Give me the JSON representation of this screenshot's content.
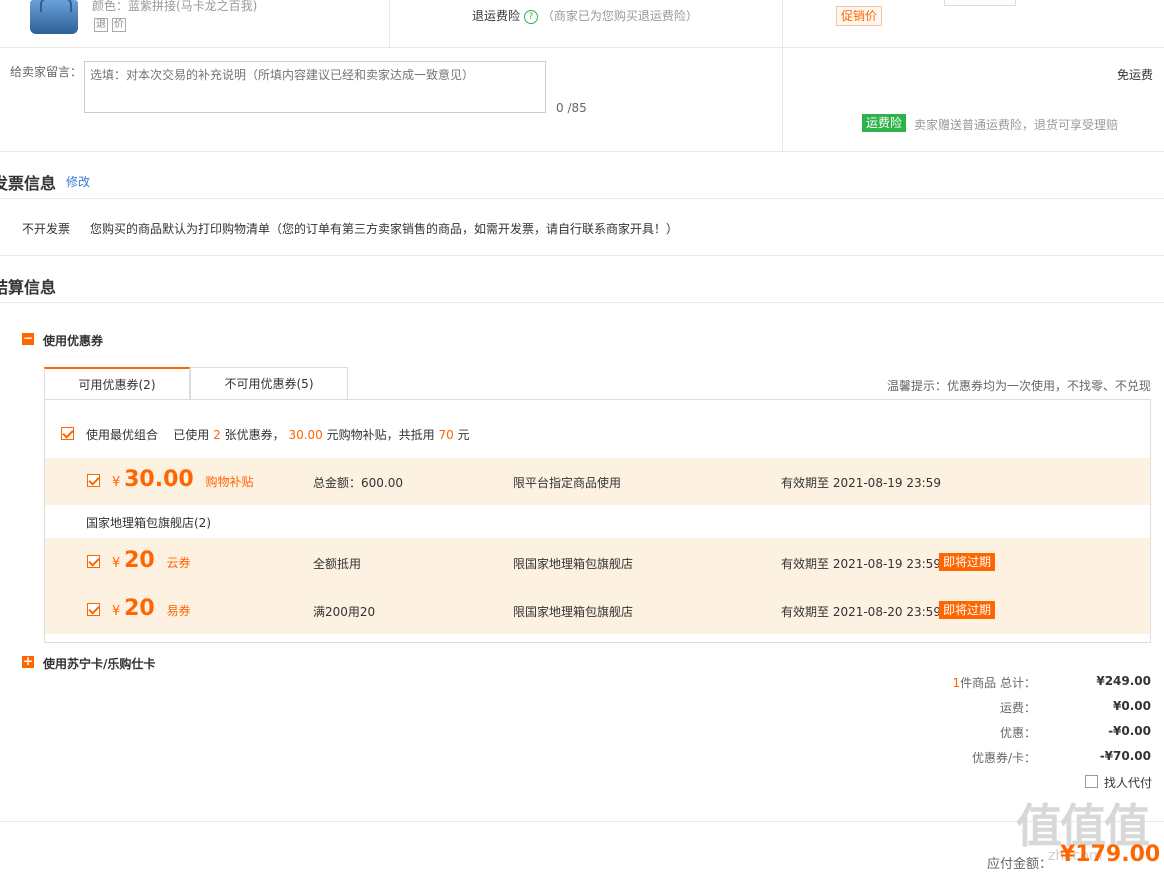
{
  "product": {
    "color_line": "颜色：蓝紫拼接(马卡龙之百我)",
    "tags": [
      "退",
      "价"
    ],
    "insurance_label": "退运费险",
    "insurance_note": "（商家已为您购买退运费险）",
    "promo_label": "促销价"
  },
  "message": {
    "label": "给卖家留言：",
    "placeholder": "选填：对本次交易的补充说明（所填内容建议已经和卖家达成一致意见）",
    "counter": "0 /85",
    "shipping": "免运费",
    "insurance_badge": "运费险",
    "insurance_text": "卖家赠送普通运费险，退货可享受理赔"
  },
  "invoice": {
    "title": "发票信息",
    "edit_link": "修改",
    "type": "不开发票",
    "description": "您购买的商品默认为打印购物清单（您的订单有第三方卖家销售的商品，如需开发票，请自行联系商家开具！）"
  },
  "settlement": {
    "title": "结算信息",
    "coupon_toggle": "使用优惠券",
    "tabs": [
      {
        "label": "可用优惠券(2)"
      },
      {
        "label": "不可用优惠券(5)"
      }
    ],
    "tip": "温馨提示：优惠券均为一次使用，不找零、不兑现",
    "best_combo": {
      "label": "使用最优组合",
      "prefix": "已使用",
      "count": "2",
      "mid1": "张优惠券，",
      "subsidy": "30.00",
      "mid2": "元购物补贴，共抵用",
      "total": "70",
      "suffix": "元"
    },
    "platform_coupon": {
      "yen": "¥",
      "amount": "30.00",
      "type": "购物补贴",
      "condition": "总金额：600.00",
      "scope": "限平台指定商品使用",
      "expiry": "有效期至 2021-08-19 23:59"
    },
    "store_name": "国家地理箱包旗舰店(2)",
    "store_coupons": [
      {
        "yen": "¥",
        "amount": "20",
        "type": "云券",
        "condition": "全额抵用",
        "scope": "限国家地理箱包旗舰店",
        "expiry": "有效期至 2021-08-19 23:59",
        "badge": "即将过期"
      },
      {
        "yen": "¥",
        "amount": "20",
        "type": "易券",
        "condition": "满200用20",
        "scope": "限国家地理箱包旗舰店",
        "expiry": "有效期至 2021-08-20 23:59",
        "badge": "即将过期"
      }
    ],
    "card_toggle": "使用苏宁卡/乐购仕卡"
  },
  "summary": {
    "items_count": "1",
    "items_label": "件商品 总计：",
    "items_total": "¥249.00",
    "shipping_label": "运费：",
    "shipping_value": "¥0.00",
    "discount_label": "优惠：",
    "discount_value": "-¥0.00",
    "coupon_label": "优惠券/卡：",
    "coupon_value": "-¥70.00",
    "proxy_pay": "找人代付",
    "pay_label": "应付金额：",
    "pay_value": "¥179.00"
  },
  "watermark": {
    "main": "值值值",
    "sub": "zhi.com"
  },
  "colors": {
    "accent": "#ff6600",
    "coupon_bg": "#fdf1e1",
    "green": "#2db34a",
    "link": "#3a7bd5"
  }
}
